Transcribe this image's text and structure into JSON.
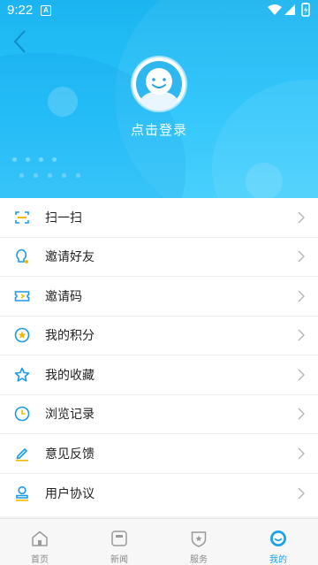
{
  "status_bar": {
    "time": "9:22",
    "notification_icon": "A"
  },
  "header": {
    "back_icon": "chevron-left-icon",
    "avatar_icon": "default-avatar-icon",
    "login_label": "点击登录"
  },
  "menu": {
    "items": [
      {
        "label": "扫一扫",
        "icon": "scan-icon"
      },
      {
        "label": "邀请好友",
        "icon": "lightbulb-icon"
      },
      {
        "label": "邀请码",
        "icon": "ticket-icon"
      },
      {
        "label": "我的积分",
        "icon": "points-coin-icon"
      },
      {
        "label": "我的收藏",
        "icon": "star-icon"
      },
      {
        "label": "浏览记录",
        "icon": "clock-icon"
      },
      {
        "label": "意见反馈",
        "icon": "pencil-icon"
      },
      {
        "label": "用户协议",
        "icon": "user-stamp-icon"
      }
    ]
  },
  "tabbar": {
    "tabs": [
      {
        "label": "首页",
        "icon": "home-icon",
        "active": false
      },
      {
        "label": "新闻",
        "icon": "news-icon",
        "active": false
      },
      {
        "label": "服务",
        "icon": "service-shield-icon",
        "active": false
      },
      {
        "label": "我的",
        "icon": "profile-icon",
        "active": true
      }
    ]
  },
  "colors": {
    "header_top": "#1bb4f0",
    "header_bottom": "#3ecdfc",
    "accent": "#1aa3e8",
    "icon_yellow": "#f5b800"
  }
}
